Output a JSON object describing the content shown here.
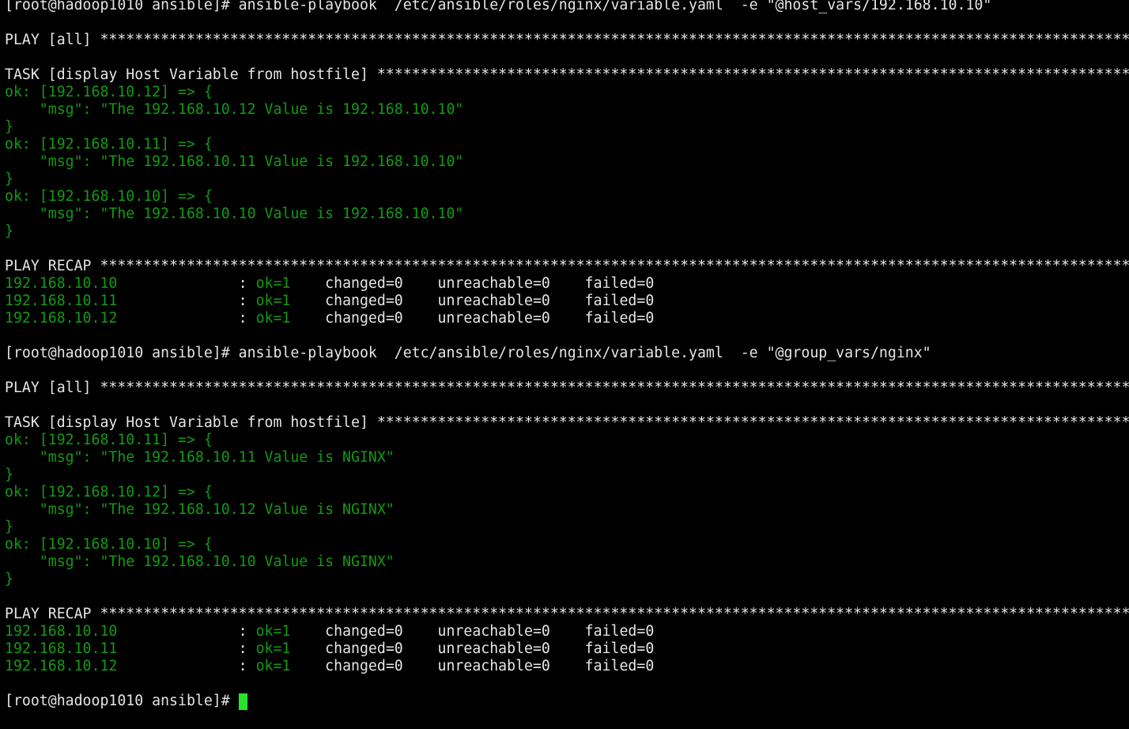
{
  "colors": {
    "background": "#000000",
    "default_text": "#e6e6e6",
    "ok_text": "#129a12",
    "cursor": "#2be22b"
  },
  "terminal": {
    "lines": [
      [
        {
          "text": "[root@hadoop1010 ansible]# ansible-playbook  /etc/ansible/roles/nginx/variable.yaml  -e \"@host_vars/192.168.10.10\"",
          "color": "white"
        }
      ],
      [],
      [
        {
          "text": "PLAY [all] ****************************************************************************************************************************************************************************",
          "color": "white"
        }
      ],
      [],
      [
        {
          "text": "TASK [display Host Variable from hostfile] ********************************************************************************************************************************************",
          "color": "white"
        }
      ],
      [
        {
          "text": "ok: [192.168.10.12] => {",
          "color": "green"
        }
      ],
      [
        {
          "text": "    \"msg\": \"The 192.168.10.12 Value is 192.168.10.10\"",
          "color": "green"
        }
      ],
      [
        {
          "text": "}",
          "color": "green"
        }
      ],
      [
        {
          "text": "ok: [192.168.10.11] => {",
          "color": "green"
        }
      ],
      [
        {
          "text": "    \"msg\": \"The 192.168.10.11 Value is 192.168.10.10\"",
          "color": "green"
        }
      ],
      [
        {
          "text": "}",
          "color": "green"
        }
      ],
      [
        {
          "text": "ok: [192.168.10.10] => {",
          "color": "green"
        }
      ],
      [
        {
          "text": "    \"msg\": \"The 192.168.10.10 Value is 192.168.10.10\"",
          "color": "green"
        }
      ],
      [
        {
          "text": "}",
          "color": "green"
        }
      ],
      [],
      [
        {
          "text": "PLAY RECAP ****************************************************************************************************************************************************************************",
          "color": "white"
        }
      ],
      [
        {
          "text": "192.168.10.10              ",
          "color": "green"
        },
        {
          "text": ": ",
          "color": "white"
        },
        {
          "text": "ok=1",
          "color": "green"
        },
        {
          "text": "    changed=0    unreachable=0    failed=0",
          "color": "white"
        }
      ],
      [
        {
          "text": "192.168.10.11              ",
          "color": "green"
        },
        {
          "text": ": ",
          "color": "white"
        },
        {
          "text": "ok=1",
          "color": "green"
        },
        {
          "text": "    changed=0    unreachable=0    failed=0",
          "color": "white"
        }
      ],
      [
        {
          "text": "192.168.10.12              ",
          "color": "green"
        },
        {
          "text": ": ",
          "color": "white"
        },
        {
          "text": "ok=1",
          "color": "green"
        },
        {
          "text": "    changed=0    unreachable=0    failed=0",
          "color": "white"
        }
      ],
      [],
      [
        {
          "text": "[root@hadoop1010 ansible]# ansible-playbook  /etc/ansible/roles/nginx/variable.yaml  -e \"@group_vars/nginx\"",
          "color": "white"
        }
      ],
      [],
      [
        {
          "text": "PLAY [all] ****************************************************************************************************************************************************************************",
          "color": "white"
        }
      ],
      [],
      [
        {
          "text": "TASK [display Host Variable from hostfile] ********************************************************************************************************************************************",
          "color": "white"
        }
      ],
      [
        {
          "text": "ok: [192.168.10.11] => {",
          "color": "green"
        }
      ],
      [
        {
          "text": "    \"msg\": \"The 192.168.10.11 Value is NGINX\"",
          "color": "green"
        }
      ],
      [
        {
          "text": "}",
          "color": "green"
        }
      ],
      [
        {
          "text": "ok: [192.168.10.12] => {",
          "color": "green"
        }
      ],
      [
        {
          "text": "    \"msg\": \"The 192.168.10.12 Value is NGINX\"",
          "color": "green"
        }
      ],
      [
        {
          "text": "}",
          "color": "green"
        }
      ],
      [
        {
          "text": "ok: [192.168.10.10] => {",
          "color": "green"
        }
      ],
      [
        {
          "text": "    \"msg\": \"The 192.168.10.10 Value is NGINX\"",
          "color": "green"
        }
      ],
      [
        {
          "text": "}",
          "color": "green"
        }
      ],
      [],
      [
        {
          "text": "PLAY RECAP ****************************************************************************************************************************************************************************",
          "color": "white"
        }
      ],
      [
        {
          "text": "192.168.10.10              ",
          "color": "green"
        },
        {
          "text": ": ",
          "color": "white"
        },
        {
          "text": "ok=1",
          "color": "green"
        },
        {
          "text": "    changed=0    unreachable=0    failed=0",
          "color": "white"
        }
      ],
      [
        {
          "text": "192.168.10.11              ",
          "color": "green"
        },
        {
          "text": ": ",
          "color": "white"
        },
        {
          "text": "ok=1",
          "color": "green"
        },
        {
          "text": "    changed=0    unreachable=0    failed=0",
          "color": "white"
        }
      ],
      [
        {
          "text": "192.168.10.12              ",
          "color": "green"
        },
        {
          "text": ": ",
          "color": "white"
        },
        {
          "text": "ok=1",
          "color": "green"
        },
        {
          "text": "    changed=0    unreachable=0    failed=0",
          "color": "white"
        }
      ],
      [],
      [
        {
          "text": "[root@hadoop1010 ansible]# ",
          "color": "white"
        }
      ]
    ],
    "cursor_icon": "block-cursor-icon"
  }
}
